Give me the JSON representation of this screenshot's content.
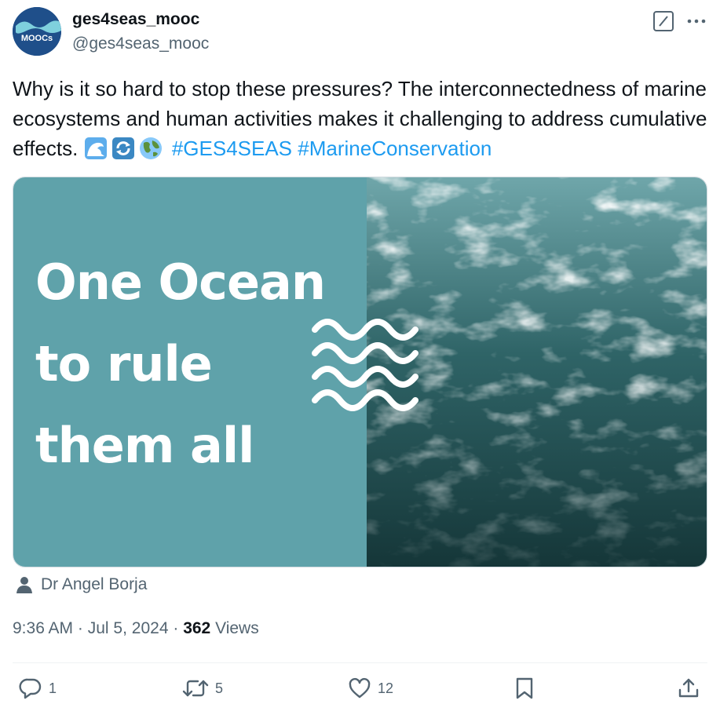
{
  "author": {
    "display_name": "ges4seas_mooc",
    "handle": "@ges4seas_mooc",
    "avatar_text": "MOOCs"
  },
  "tweet": {
    "text": "Why is it so hard to stop these pressures? The interconnectedness of marine ecosystems and human activities makes it challenging to address cumulative effects.",
    "emojis": [
      "water-wave-icon",
      "arrows-cycle-icon",
      "globe-icon"
    ],
    "hashtags": [
      "#GES4SEAS",
      "#MarineConservation"
    ]
  },
  "media": {
    "line1": "One Ocean",
    "line2": "to rule",
    "line3": "them all",
    "left_color": "#5fa2aa"
  },
  "tagged": {
    "person": "Dr Angel Borja"
  },
  "meta": {
    "time": "9:36 AM",
    "separator": "·",
    "date": "Jul 5, 2024",
    "views_count": "362",
    "views_label": "Views"
  },
  "actions": {
    "replies": "1",
    "reposts": "5",
    "likes": "12"
  },
  "colors": {
    "accent": "#1d9bf0",
    "secondary_text": "#536471"
  }
}
